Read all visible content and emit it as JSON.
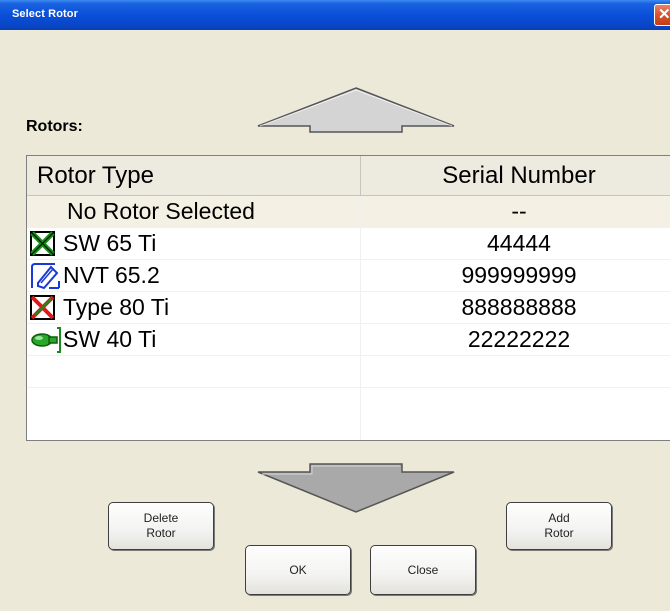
{
  "window": {
    "title": "Select Rotor",
    "close_glyph": "✕"
  },
  "rotors_label": "Rotors:",
  "table": {
    "columns": [
      "Rotor Type",
      "Serial Number"
    ],
    "rows": [
      {
        "type": "No Rotor Selected",
        "serial": "--",
        "icon": "none",
        "selected": true
      },
      {
        "type": "SW  65 Ti",
        "serial": "44444",
        "icon": "sw-rotor-icon-green-x",
        "selected": false
      },
      {
        "type": "NVT  65.2",
        "serial": "999999999",
        "icon": "nvt-rotor-icon-blue",
        "selected": false
      },
      {
        "type": "Type  80 Ti",
        "serial": "888888888",
        "icon": "fixed-angle-rotor-icon-red-x",
        "selected": false
      },
      {
        "type": "SW  40 Ti",
        "serial": "22222222",
        "icon": "sw-rotor-icon-green-bucket",
        "selected": false
      }
    ]
  },
  "buttons": {
    "delete_rotor": "Delete\nRotor",
    "add_rotor": "Add\nRotor",
    "ok": "OK",
    "close": "Close"
  },
  "colors": {
    "dialog_background": "#ece9d8",
    "title_bar": "#0a4fd9",
    "selected_row": "#f4f1e4",
    "header_row": "#edebe0"
  }
}
